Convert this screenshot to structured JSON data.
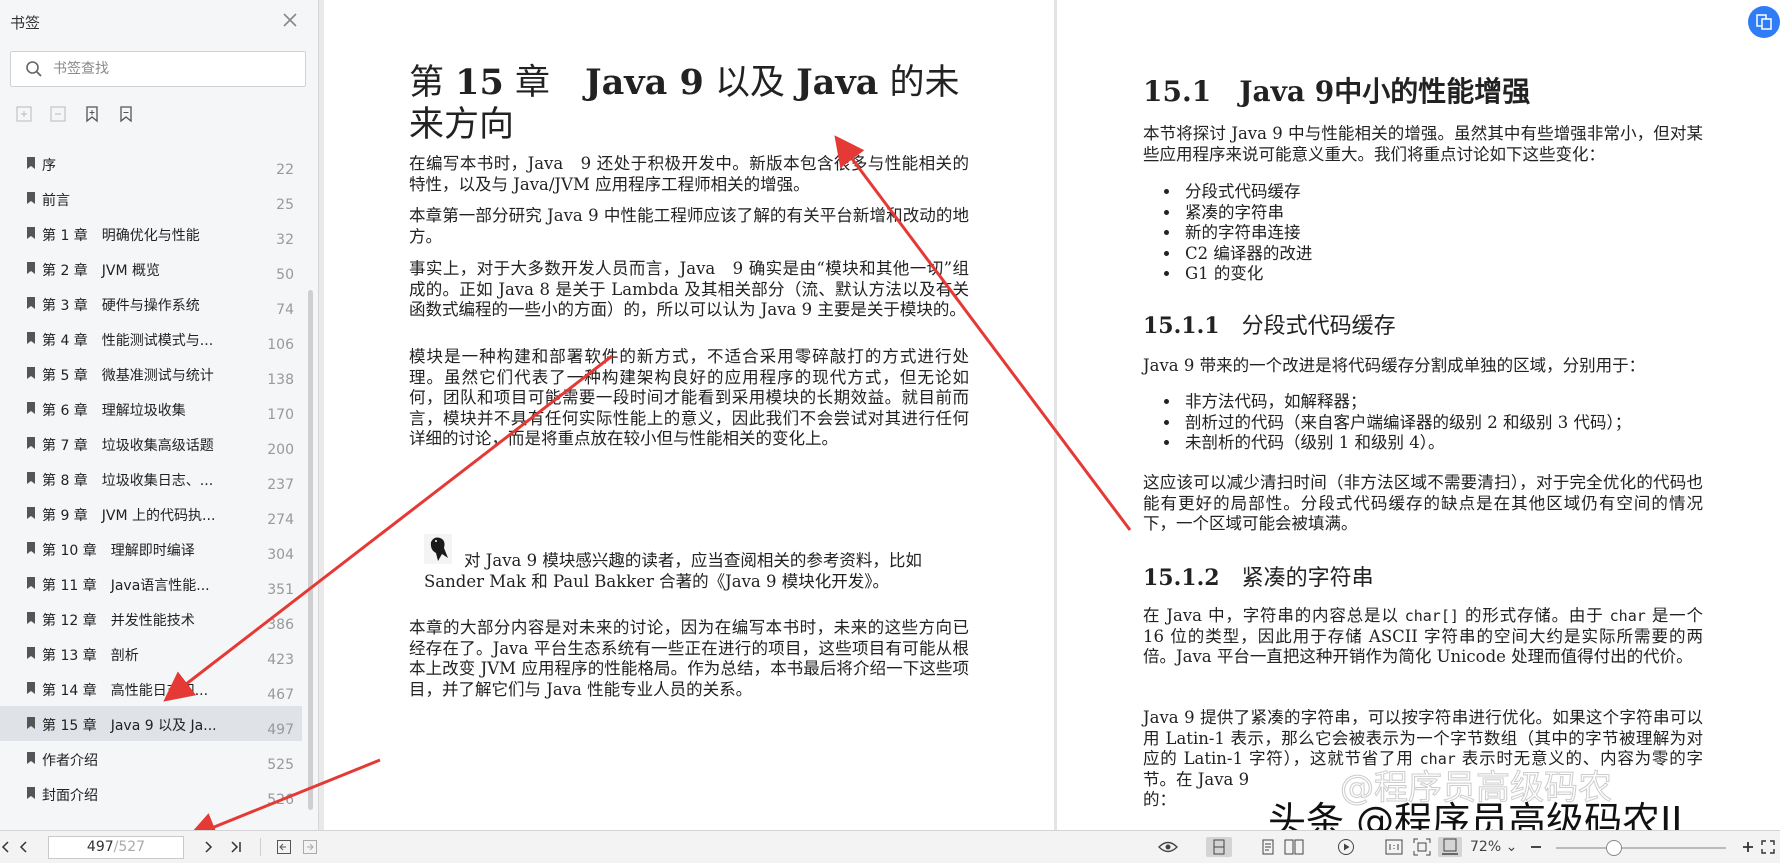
{
  "sidebar": {
    "title": "书签",
    "search_placeholder": "书签查找",
    "items": [
      {
        "label": "序",
        "page": "22"
      },
      {
        "label": "前言",
        "page": "25"
      },
      {
        "label": "第 1 章　明确优化与性能",
        "page": "32"
      },
      {
        "label": "第 2 章　JVM 概览",
        "page": "50"
      },
      {
        "label": "第 3 章　硬件与操作系统",
        "page": "74"
      },
      {
        "label": "第 4 章　性能测试模式与...",
        "page": "106"
      },
      {
        "label": "第 5 章　微基准测试与统计",
        "page": "138"
      },
      {
        "label": "第 6 章　理解垃圾收集",
        "page": "170"
      },
      {
        "label": "第 7 章　垃圾收集高级话题",
        "page": "200"
      },
      {
        "label": "第 8 章　垃圾收集日志、...",
        "page": "237"
      },
      {
        "label": "第 9 章　JVM 上的代码执...",
        "page": "274"
      },
      {
        "label": "第 10 章　理解即时编译",
        "page": "304"
      },
      {
        "label": "第 11 章　Java语言性能...",
        "page": "351"
      },
      {
        "label": "第 12 章　并发性能技术",
        "page": "386"
      },
      {
        "label": "第 13 章　剖析",
        "page": "423"
      },
      {
        "label": "第 14 章　高性能日志和...",
        "page": "467"
      },
      {
        "label": "第 15 章　Java 9 以及 Ja...",
        "page": "497"
      },
      {
        "label": "作者介绍",
        "page": "525"
      },
      {
        "label": "封面介绍",
        "page": "526"
      }
    ],
    "active_index": 16
  },
  "left_page": {
    "chapter_prefix": "第",
    "chapter_num": "15",
    "chapter_mid": "章　",
    "title_java9": "Java 9",
    "title_mid": " 以及 ",
    "title_java": "Java",
    "title_tail": " 的未来方向",
    "paragraphs": [
      "在编写本书时，Java　9 还处于积极开发中。新版本包含很多与性能相关的特性，以及与 Java/JVM 应用程序工程师相关的增强。",
      "本章第一部分研究 Java 9 中性能工程师应该了解的有关平台新增和改动的地方。",
      "事实上，对于大多数开发人员而言，Java　9 确实是由“模块和其他一切”组成的。正如 Java 8 是关于 Lambda 及其相关部分（流、默认方法以及有关函数式编程的一些小的方面）的，所以可以认为 Java 9 主要是关于模块的。",
      "模块是一种构建和部署软件的新方式，不适合采用零碎敲打的方式进行处理。虽然它们代表了一种构建架构良好的应用程序的现代方式，但无论如何，团队和项目可能需要一段时间才能看到采用模块的长期效益。就目前而言，模块并不具有任何实际性能上的意义，因此我们不会尝试对其进行任何详细的讨论，而是将重点放在较小但与性能相关的变化上。",
      "本章的大部分内容是对未来的讨论，因为在编写本书时，未来的这些方向已经存在了。Java 平台生态系统有一些正在进行的项目，这些项目有可能从根本上改变 JVM 应用程序的性能格局。作为总结，本书最后将介绍一下这些项目，并了解它们与 Java 性能专业人员的关系。"
    ],
    "note": "对 Java 9 模块感兴趣的读者，应当查阅相关的参考资料，比如 Sander Mak 和 Paul Bakker 合著的《Java 9 模块化开发》。"
  },
  "right_page": {
    "h2_num": "15.1",
    "h2_text": "Java 9中小的性能增强",
    "intro": "本节将探讨 Java 9 中与性能相关的增强。虽然其中有些增强非常小，但对某些应用程序来说可能意义重大。我们将重点讨论如下这些变化：",
    "list1": [
      "分段式代码缓存",
      "紧凑的字符串",
      "新的字符串连接",
      "C2 编译器的改进",
      "G1 的变化"
    ],
    "h3a_num": "15.1.1",
    "h3a_text": "分段式代码缓存",
    "p_a": "Java 9 带来的一个改进是将代码缓存分割成单独的区域，分别用于：",
    "list2": [
      "非方法代码，如解释器；",
      "剖析过的代码（来自客户端编译器的级别 2 和级别 3 代码）；",
      "未剖析的代码（级别 1 和级别 4）。"
    ],
    "p_b": "这应该可以减少清扫时间（非方法区域不需要清扫），对于完全优化的代码也能有更好的局部性。分段式代码缓存的缺点是在其他区域仍有空间的情况下，一个区域可能会被填满。",
    "h3b_num": "15.1.2",
    "h3b_text": "紧凑的字符串",
    "p_c1": "在 Java 中，字符串的内容总是以 ",
    "p_c_code1": "char[]",
    "p_c2": " 的形式存储。由于 ",
    "p_c_code2": "char",
    "p_c3": " 是一个 16 位的类型，因此用于存储 ASCII 字符串的空间大约是实际所需要的两倍。Java 平台一直把这种开销作为简化 Unicode 处理而值得付出的代价。",
    "p_d1": "Java 9 提供了紧凑的字符串，可以按字符串进行优化。如果这个字符串可以用 Latin-1 表示，那么它会被表示为一个字节数组（其中的字节被理解为对应的 Latin-1 字符），这就节省了用 ",
    "p_d_code": "char",
    "p_d2": " 表示时无意义的、内容为零的字节。在 Java 9",
    "p_d3": "的："
  },
  "watermark": {
    "outline": "@程序员高级码农",
    "main": "头条 @程序员高级码农II"
  },
  "toolbar": {
    "current_page": "497",
    "total_pages": "/527",
    "zoom": "72%"
  },
  "colors": {
    "accent": "#2f7cf6",
    "arrow": "#e53935",
    "active_bookmark_bg": "#dfe3e8"
  }
}
